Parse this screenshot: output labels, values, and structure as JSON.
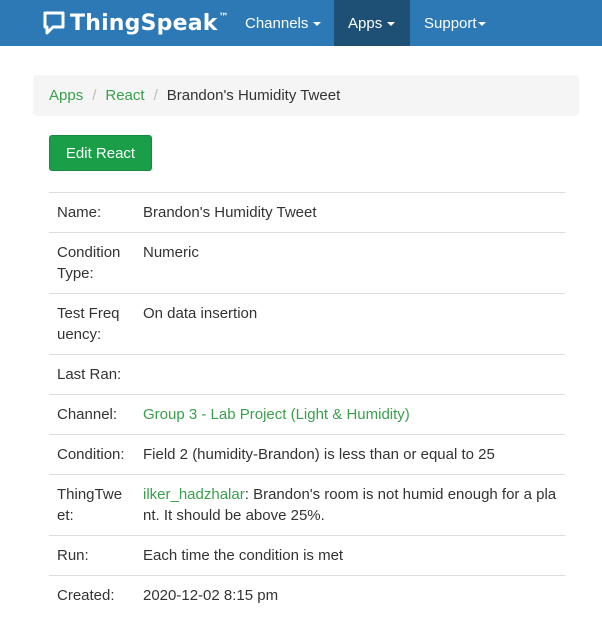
{
  "navbar": {
    "brand": "ThingSpeak",
    "brand_tm": "™",
    "items": [
      {
        "label": "Channels",
        "active": false
      },
      {
        "label": "Apps",
        "active": true
      },
      {
        "label": "Support",
        "active": false
      }
    ]
  },
  "breadcrumb": {
    "items": [
      "Apps",
      "React"
    ],
    "current": "Brandon's Humidity Tweet"
  },
  "edit_button": "Edit React",
  "details": {
    "name": {
      "label": "Name:",
      "value": "Brandon's Humidity Tweet"
    },
    "condition_type": {
      "label": "Condition Type:",
      "value": "Numeric"
    },
    "test_frequency": {
      "label": "Test Frequency:",
      "value": "On data insertion"
    },
    "last_ran": {
      "label": "Last Ran:",
      "value": ""
    },
    "channel": {
      "label": "Channel:",
      "value": "Group 3 - Lab Project (Light & Humidity)"
    },
    "condition": {
      "label": "Condition:",
      "value": "Field 2 (humidity-Brandon) is less than or equal to 25"
    },
    "thingtweet": {
      "label": "ThingTweet:",
      "account": "ilker_hadzhalar",
      "message": ": Brandon's room is not humid enough for a plant. It should be above 25%."
    },
    "run": {
      "label": "Run:",
      "value": "Each time the condition is met"
    },
    "created": {
      "label": "Created:",
      "value": "2020-12-02 8:15 pm"
    }
  },
  "colors": {
    "navbar": "#2c79b5",
    "nav_active": "#1e4f75",
    "link": "#3aa04c",
    "button": "#1a9e47"
  },
  "icons": [
    "chat-bubble-logo-icon",
    "caret-down-icon"
  ]
}
